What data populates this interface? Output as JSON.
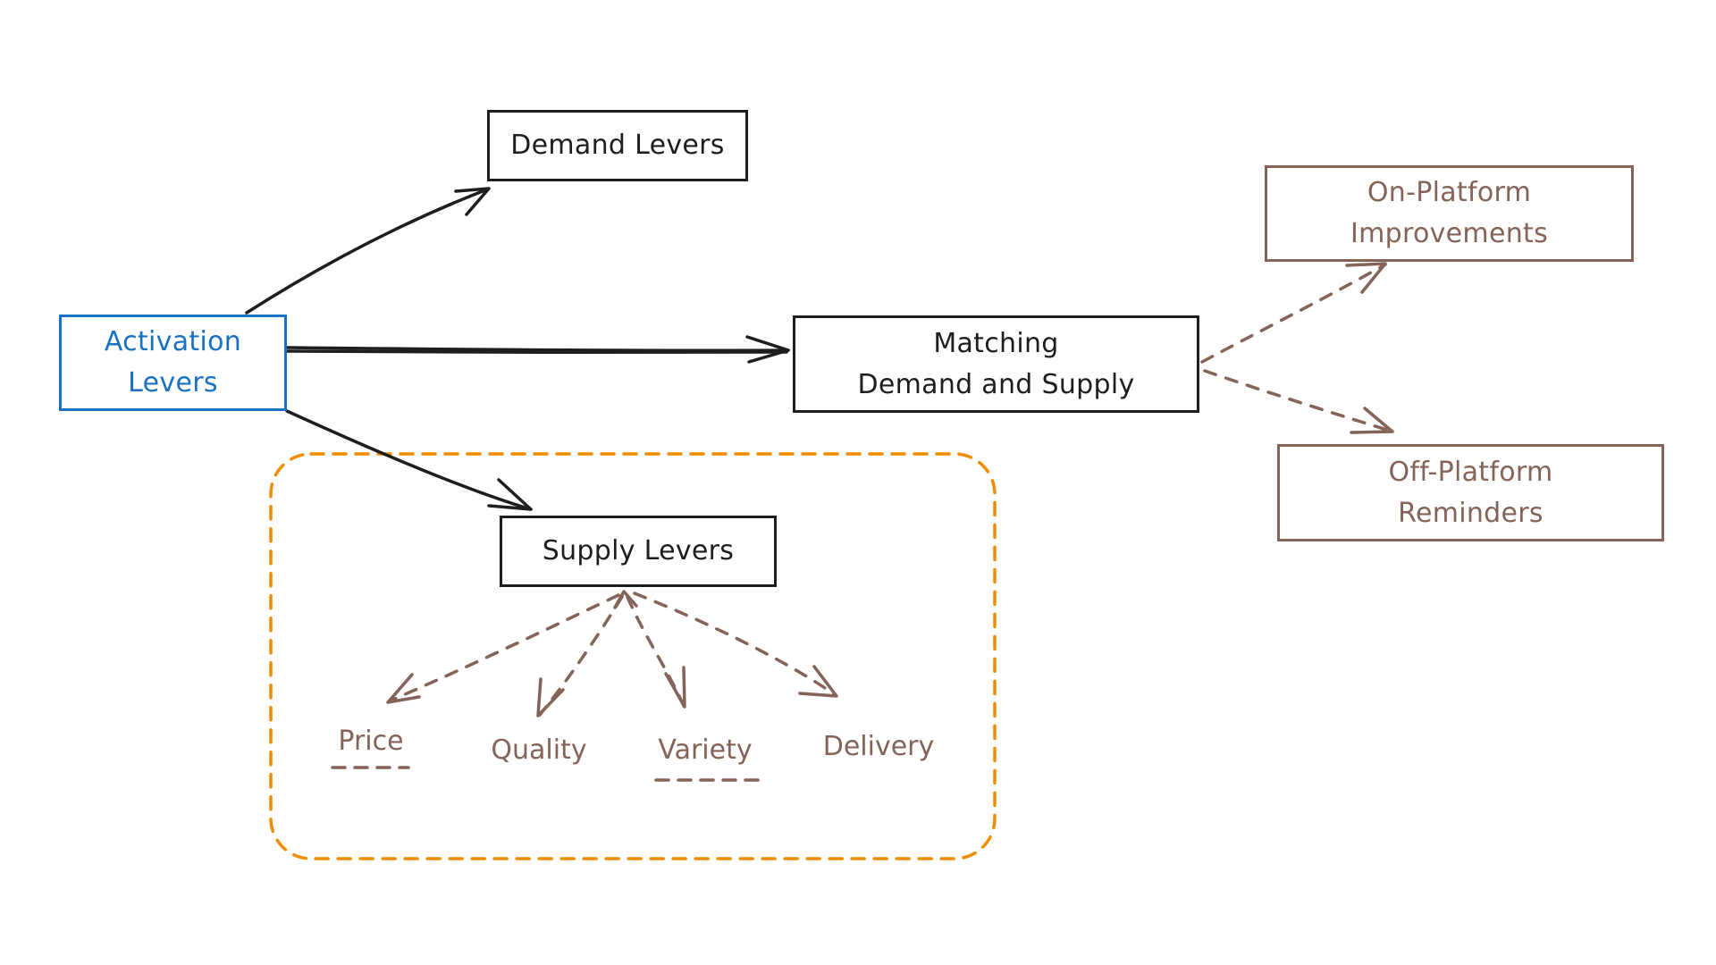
{
  "colors": {
    "black": "#1e1e1e",
    "blue": "#1971c2",
    "brown": "#846358",
    "orange": "#f08c00",
    "background": "#ffffff"
  },
  "nodes": {
    "activation": {
      "lines": [
        "Activation",
        "Levers"
      ]
    },
    "demand": {
      "lines": [
        "Demand Levers"
      ]
    },
    "matching": {
      "lines": [
        "Matching",
        "Demand and Supply"
      ]
    },
    "on_platform": {
      "lines": [
        "On-Platform",
        "Improvements"
      ]
    },
    "off_platform": {
      "lines": [
        "Off-Platform",
        "Reminders"
      ]
    },
    "supply": {
      "lines": [
        "Supply Levers"
      ]
    }
  },
  "supply_factors": [
    {
      "label": "Price",
      "underlined": true
    },
    {
      "label": "Quality",
      "underlined": false
    },
    {
      "label": "Variety",
      "underlined": true
    },
    {
      "label": "Delivery",
      "underlined": false
    }
  ],
  "edges": [
    {
      "from": "Activation Levers",
      "to": "Demand Levers",
      "style": "solid"
    },
    {
      "from": "Activation Levers",
      "to": "Matching Demand and Supply",
      "style": "solid"
    },
    {
      "from": "Activation Levers",
      "to": "Supply Levers",
      "style": "solid"
    },
    {
      "from": "Matching Demand and Supply",
      "to": "On-Platform Improvements",
      "style": "dashed"
    },
    {
      "from": "Matching Demand and Supply",
      "to": "Off-Platform Reminders",
      "style": "dashed"
    },
    {
      "from": "Supply Levers",
      "to": "Price",
      "style": "dashed"
    },
    {
      "from": "Supply Levers",
      "to": "Quality",
      "style": "dashed"
    },
    {
      "from": "Supply Levers",
      "to": "Variety",
      "style": "dashed"
    },
    {
      "from": "Supply Levers",
      "to": "Delivery",
      "style": "dashed"
    }
  ],
  "group": {
    "label": "supply-levers-group",
    "style": "dashed"
  }
}
